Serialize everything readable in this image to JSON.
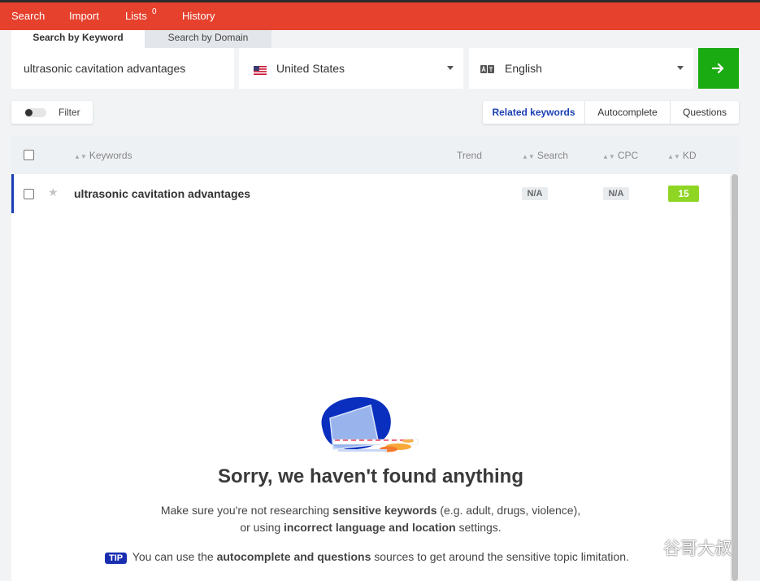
{
  "nav": {
    "search": "Search",
    "import": "Import",
    "lists": "Lists",
    "lists_count": "0",
    "history": "History",
    "bg_color": "#e5412d"
  },
  "mode_tabs": {
    "by_keyword": "Search by Keyword",
    "by_domain": "Search by Domain"
  },
  "search": {
    "keyword_value": "ultrasonic cavitation advantages",
    "location": "United States",
    "language": "English",
    "go_icon": "arrow-right-icon"
  },
  "filter": {
    "label": "Filter",
    "enabled": false
  },
  "source_tabs": {
    "related": "Related keywords",
    "autocomplete": "Autocomplete",
    "questions": "Questions",
    "active": "Related keywords"
  },
  "table": {
    "headers": {
      "keywords": "Keywords",
      "trend": "Trend",
      "search": "Search",
      "cpc": "CPC",
      "kd": "KD"
    },
    "rows": [
      {
        "keyword": "ultrasonic cavitation advantages",
        "search": "N/A",
        "cpc": "N/A",
        "kd": "15",
        "kd_color": "#8fd624"
      }
    ]
  },
  "empty_state": {
    "title": "Sorry, we haven't found anything",
    "line1_pre": "Make sure you're not researching ",
    "line1_bold": "sensitive keywords",
    "line1_post": " (e.g. adult, drugs, violence),",
    "line2_pre": "or using ",
    "line2_bold": "incorrect language and location",
    "line2_post": " settings.",
    "tip_badge": "TIP",
    "tip_pre": " You can use the ",
    "tip_bold": "autocomplete and questions",
    "tip_post": " sources to get around the sensitive topic limitation."
  },
  "watermark": {
    "text": "谷哥大叔",
    "icon": "wechat-icon"
  }
}
